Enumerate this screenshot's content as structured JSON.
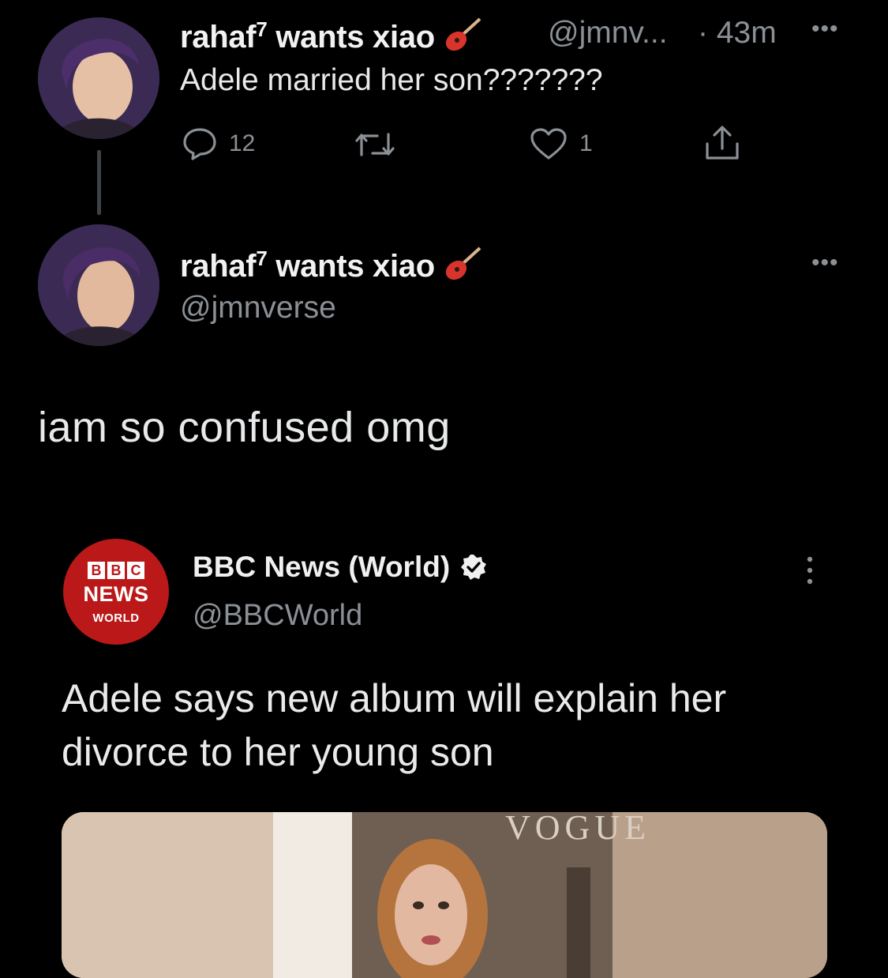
{
  "tweet1": {
    "display_name": "rahaf",
    "superscript": "7",
    "name_suffix": "wants xiao",
    "name_emoji": "guitar",
    "handle_short": "@jmnv...",
    "time": "· 43m",
    "text": "Adele married her son???????",
    "actions": {
      "reply_count": "12",
      "retweet_count": "",
      "like_count": "1"
    }
  },
  "tweet2": {
    "display_name": "rahaf",
    "superscript": "7",
    "name_suffix": "wants xiao",
    "handle": "@jmnverse",
    "text": "iam so confused omg"
  },
  "quoted": {
    "logo": {
      "blocks": [
        "B",
        "B",
        "C"
      ],
      "line1": "NEWS",
      "line2": "WORLD"
    },
    "display_name": "BBC News (World)",
    "verified": true,
    "handle": "@BBCWorld",
    "headline": "Adele says new album will explain her divorce to her young son",
    "media_text": "VOGUE"
  },
  "colors": {
    "background": "#000000",
    "text": "#e7e9ea",
    "secondary": "#8b9096",
    "bbc_red": "#bb1919"
  }
}
